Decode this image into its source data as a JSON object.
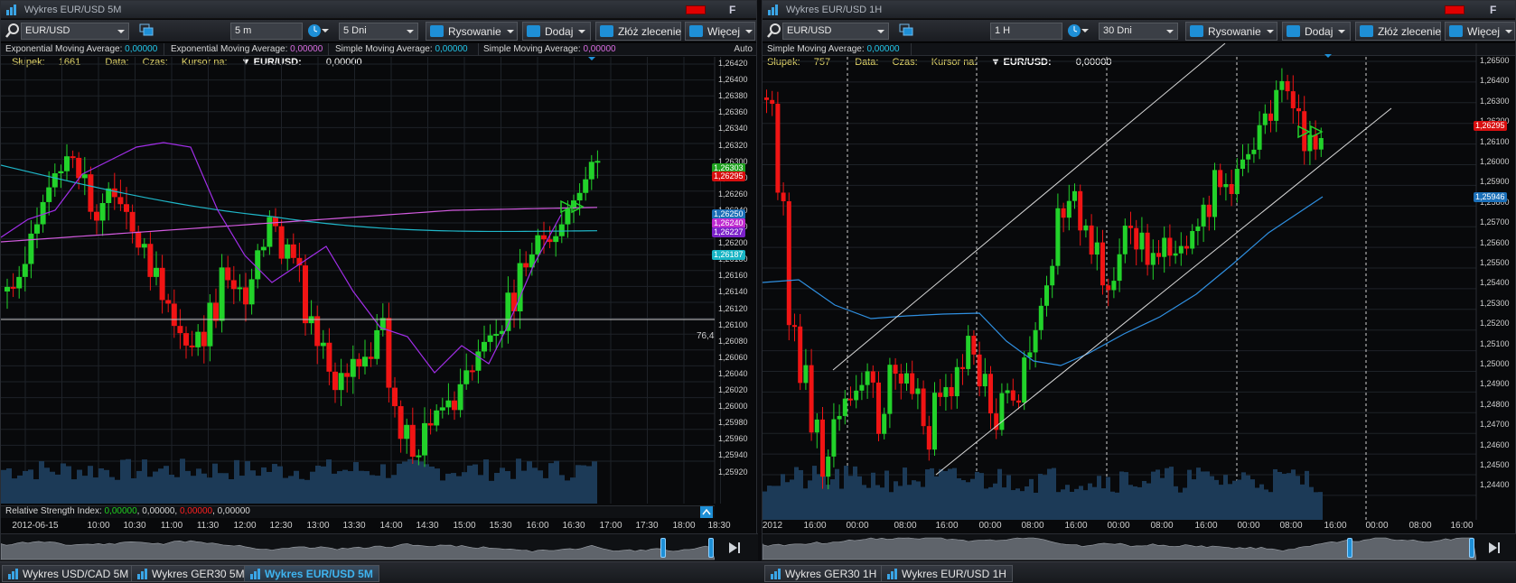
{
  "colors": {
    "bull": "#22d22a",
    "bear": "#f01414",
    "ema_cyan": "#1fb6c8",
    "sma_magenta": "#d35be0",
    "ema_purple": "#a12ee8",
    "sma_blue": "#2f8fe0",
    "volume": "#1c3a57",
    "grid": "#1e2228"
  },
  "left": {
    "window_title": "Wykres EUR/USD 5M",
    "f_label": "F",
    "toolbar": {
      "symbol": "EUR/USD",
      "interval": "5 m",
      "range": "5 Dni",
      "draw_label": "Rysowanie",
      "add_label": "Dodaj",
      "order_label": "Złóż zlecenie",
      "more_label": "Więcej"
    },
    "legend": [
      {
        "name": "Exponential Moving Average:",
        "value": "0,00000",
        "color": "cyan"
      },
      {
        "name": "Exponential Moving Average:",
        "value": "0,00000",
        "color": "magenta"
      },
      {
        "name": "Simple Moving Average:",
        "value": "0,00000",
        "color": "cyan"
      },
      {
        "name": "Simple Moving Average:",
        "value": "0,00000",
        "color": "magenta"
      }
    ],
    "auto_label": "Auto",
    "info": {
      "bar_label": "Słupek:",
      "bar_value": "1661",
      "date_label": "Data:",
      "time_label": "Czas:",
      "cursor_label": "Kursor na:",
      "instrument": "EUR/USD:",
      "instrument_value": "0,00000"
    },
    "price_labels": [
      "1,26420",
      "1,26400",
      "1,26380",
      "1,26360",
      "1,26340",
      "1,26320",
      "1,26300",
      "1,26280",
      "1,26260",
      "1,26240",
      "1,26220",
      "1,26200",
      "1,26180",
      "1,26160",
      "1,26140",
      "1,26120",
      "1,26100",
      "1,26080",
      "1,26060",
      "1,26040",
      "1,26020",
      "1,26000",
      "1,25980",
      "1,25960",
      "1,25940",
      "1,25920"
    ],
    "tags": [
      {
        "text": "1,26303",
        "color": "#1ea21e"
      },
      {
        "text": "1,26295",
        "color": "#d80f0f"
      },
      {
        "text": "1,26250",
        "color": "#1b6fb8"
      },
      {
        "text": "1,26240",
        "color": "#c02bd0"
      },
      {
        "text": "1,26227",
        "color": "#7b22c8"
      },
      {
        "text": "1,26187",
        "color": "#19b5c5"
      }
    ],
    "hline_label": "76,4",
    "rsi": {
      "name": "Relative Strength Index:",
      "v1": "0,00000",
      "v2": "0,00000",
      "v3": "0,00000",
      "v4": "0,00000"
    },
    "time_labels": [
      "2012-06-15",
      "10:00",
      "10:30",
      "11:00",
      "11:30",
      "12:00",
      "12:30",
      "13:00",
      "13:30",
      "14:00",
      "14:30",
      "15:00",
      "15:30",
      "16:00",
      "16:30",
      "17:00",
      "17:30",
      "18:00",
      "18:30"
    ]
  },
  "right": {
    "window_title": "Wykres EUR/USD 1H",
    "f_label": "F",
    "toolbar": {
      "symbol": "EUR/USD",
      "interval": "1 H",
      "range": "30 Dni",
      "draw_label": "Rysowanie",
      "add_label": "Dodaj",
      "order_label": "Złóż zlecenie",
      "more_label": "Więcej"
    },
    "legend": [
      {
        "name": "Simple Moving Average:",
        "value": "0,00000",
        "color": "cyan"
      }
    ],
    "info": {
      "bar_label": "Słupek:",
      "bar_value": "757",
      "date_label": "Data:",
      "time_label": "Czas:",
      "cursor_label": "Kursor na:",
      "instrument": "EUR/USD:",
      "instrument_value": "0,00000"
    },
    "price_labels": [
      "1,26500",
      "1,26400",
      "1,26300",
      "1,26200",
      "1,26100",
      "1,26000",
      "1,25900",
      "1,25800",
      "1,25700",
      "1,25600",
      "1,25500",
      "1,25400",
      "1,25300",
      "1,25200",
      "1,25100",
      "1,25000",
      "1,24900",
      "1,24800",
      "1,24700",
      "1,24600",
      "1,24500",
      "1,24400"
    ],
    "tags": [
      {
        "text": "1,26295",
        "color": "#d80f0f"
      },
      {
        "text": "1,25946",
        "color": "#1b6fb8"
      }
    ],
    "time_labels": [
      "2012",
      "16:00",
      "00:00",
      "08:00",
      "16:00",
      "00:00",
      "08:00",
      "16:00",
      "00:00",
      "08:00",
      "16:00",
      "00:00",
      "08:00",
      "16:00",
      "00:00",
      "08:00",
      "16:00"
    ]
  },
  "taskbar": [
    {
      "label": "Wykres USD/CAD 5M",
      "active": false
    },
    {
      "label": "Wykres GER30 5M",
      "active": false
    },
    {
      "label": "Wykres EUR/USD 5M",
      "active": true
    },
    {
      "label": "Wykres GER30 1H",
      "active": false
    },
    {
      "label": "Wykres EUR/USD 1H",
      "active": false
    }
  ]
}
